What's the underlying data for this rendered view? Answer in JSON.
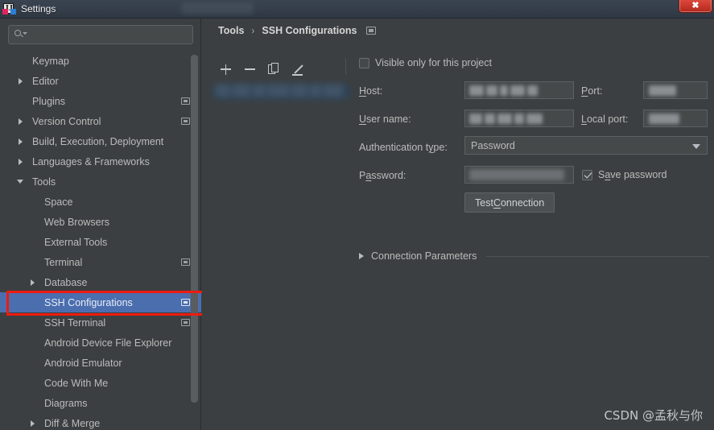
{
  "window": {
    "title": "Settings",
    "app_icon": "intellij-idea-icon",
    "close_label": "✖"
  },
  "sidebar": {
    "search": {
      "value": "",
      "placeholder": "",
      "icon": "search-icon"
    },
    "items": [
      {
        "label": "Keymap",
        "indent": 40,
        "arrow": "none",
        "badge": false,
        "selected": false
      },
      {
        "label": "Editor",
        "indent": 40,
        "arrow": "right",
        "badge": false,
        "selected": false
      },
      {
        "label": "Plugins",
        "indent": 40,
        "arrow": "none",
        "badge": true,
        "selected": false
      },
      {
        "label": "Version Control",
        "indent": 40,
        "arrow": "right",
        "badge": true,
        "selected": false
      },
      {
        "label": "Build, Execution, Deployment",
        "indent": 40,
        "arrow": "right",
        "badge": false,
        "selected": false
      },
      {
        "label": "Languages & Frameworks",
        "indent": 40,
        "arrow": "right",
        "badge": false,
        "selected": false
      },
      {
        "label": "Tools",
        "indent": 40,
        "arrow": "down",
        "badge": false,
        "selected": false
      },
      {
        "label": "Space",
        "indent": 55,
        "arrow": "none",
        "badge": false,
        "selected": false
      },
      {
        "label": "Web Browsers",
        "indent": 55,
        "arrow": "none",
        "badge": false,
        "selected": false
      },
      {
        "label": "External Tools",
        "indent": 55,
        "arrow": "none",
        "badge": false,
        "selected": false
      },
      {
        "label": "Terminal",
        "indent": 55,
        "arrow": "none",
        "badge": true,
        "selected": false
      },
      {
        "label": "Database",
        "indent": 55,
        "arrow": "right",
        "badge": false,
        "selected": false
      },
      {
        "label": "SSH Configurations",
        "indent": 55,
        "arrow": "none",
        "badge": true,
        "selected": true
      },
      {
        "label": "SSH Terminal",
        "indent": 55,
        "arrow": "none",
        "badge": true,
        "selected": false
      },
      {
        "label": "Android Device File Explorer",
        "indent": 55,
        "arrow": "none",
        "badge": false,
        "selected": false
      },
      {
        "label": "Android Emulator",
        "indent": 55,
        "arrow": "none",
        "badge": false,
        "selected": false
      },
      {
        "label": "Code With Me",
        "indent": 55,
        "arrow": "none",
        "badge": false,
        "selected": false
      },
      {
        "label": "Diagrams",
        "indent": 55,
        "arrow": "none",
        "badge": false,
        "selected": false
      },
      {
        "label": "Diff & Merge",
        "indent": 55,
        "arrow": "right",
        "badge": false,
        "selected": false
      }
    ]
  },
  "breadcrumb": {
    "root": "Tools",
    "separator": "›",
    "current": "SSH Configurations",
    "badge_icon": "project-scope-icon"
  },
  "list_toolbar": {
    "add": "+",
    "remove": "−",
    "copy": "copy-icon",
    "edit": "pencil-icon"
  },
  "form": {
    "visible_only_checkbox": {
      "label": "Visible only for this project",
      "checked": false
    },
    "host": {
      "label": "Host:",
      "value": "",
      "redacted": true
    },
    "port": {
      "label": "Port:",
      "value": "",
      "redacted": true
    },
    "user_name": {
      "label": "User name:",
      "value": "",
      "redacted": true
    },
    "local_port": {
      "label": "Local port:",
      "value": "",
      "redacted": true
    },
    "auth_type": {
      "label": "Authentication type:",
      "value": "Password"
    },
    "password": {
      "label": "Password:",
      "value": "",
      "redacted": true
    },
    "save_password": {
      "label": "Save password",
      "checked": true
    },
    "test_connection": "Test Connection",
    "connection_parameters": "Connection Parameters"
  },
  "watermark": "CSDN @孟秋与你",
  "colors": {
    "background": "#3c3f41",
    "selection": "#4b6eaf",
    "highlight_box": "#ee1b11",
    "text": "#bbbbbb",
    "field_bg": "#45494a"
  }
}
